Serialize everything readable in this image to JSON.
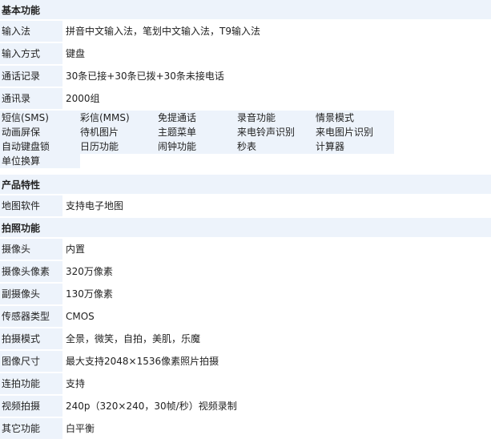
{
  "sections": {
    "basic": "基本功能",
    "product": "产品特性",
    "camera": "拍照功能"
  },
  "basic_rows": [
    {
      "k": "输入法",
      "v": "拼音中文输入法，笔划中文输入法，T9输入法"
    },
    {
      "k": "输入方式",
      "v": "键盘"
    },
    {
      "k": "通话记录",
      "v": "30条已接+30条已拨+30条未接电话"
    },
    {
      "k": "通讯录",
      "v": "2000组"
    }
  ],
  "features": [
    [
      "短信(SMS)",
      "彩信(MMS)",
      "免提通话",
      "录音功能",
      "情景模式"
    ],
    [
      "动画屏保",
      "待机图片",
      "主题菜单",
      "来电铃声识别",
      "来电图片识别"
    ],
    [
      "自动键盘锁",
      "日历功能",
      "闹钟功能",
      "秒表",
      "计算器"
    ],
    [
      "单位换算"
    ]
  ],
  "product_rows": [
    {
      "k": "地图软件",
      "v": "支持电子地图"
    }
  ],
  "camera_rows": [
    {
      "k": "摄像头",
      "v": "内置"
    },
    {
      "k": "摄像头像素",
      "v": "320万像素"
    },
    {
      "k": "副摄像头",
      "v": "130万像素"
    },
    {
      "k": "传感器类型",
      "v": "CMOS"
    },
    {
      "k": "拍摄模式",
      "v": "全景，微笑，自拍，美肌，乐魔"
    },
    {
      "k": "图像尺寸",
      "v": "最大支持2048×1536像素照片拍摄"
    },
    {
      "k": "连拍功能",
      "v": "支持"
    },
    {
      "k": "视频拍摄",
      "v": "240p（320×240，30帧/秒）视频录制"
    },
    {
      "k": "其它功能",
      "v": "白平衡"
    }
  ]
}
